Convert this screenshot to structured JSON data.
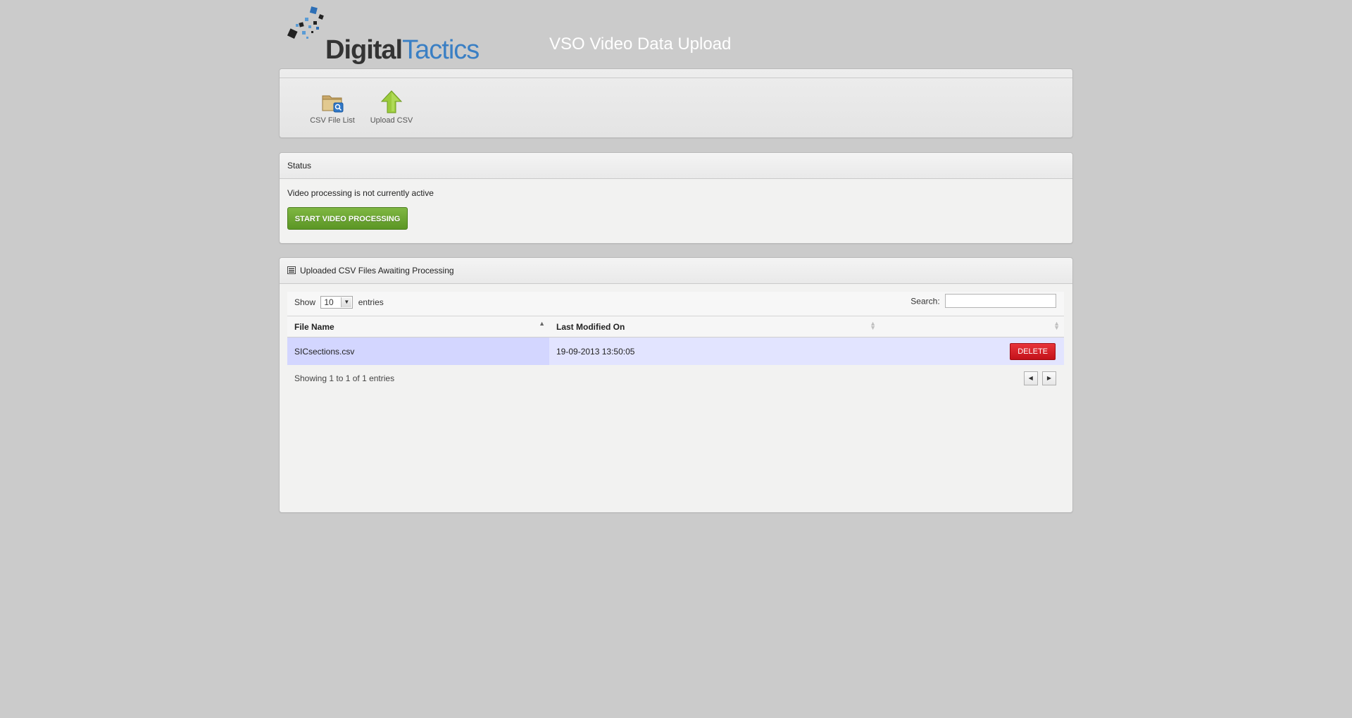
{
  "header": {
    "logo_part1": "Digital",
    "logo_part2": "Tactics",
    "title": "VSO Video Data Upload"
  },
  "toolbar": {
    "items": [
      {
        "label": "CSV File List",
        "icon": "folder-search-icon"
      },
      {
        "label": "Upload CSV",
        "icon": "upload-arrow-icon"
      }
    ]
  },
  "status": {
    "title": "Status",
    "message": "Video processing is not currently active",
    "button_label": "START VIDEO PROCESSING"
  },
  "files": {
    "title": "Uploaded CSV Files Awaiting Processing",
    "show_label": "Show",
    "entries_label": "entries",
    "length_value": "10",
    "search_label": "Search:",
    "search_value": "",
    "columns": [
      "File Name",
      "Last Modified On",
      ""
    ],
    "rows": [
      {
        "file_name": "SICsections.csv",
        "modified": "19-09-2013 13:50:05",
        "action": "DELETE"
      }
    ],
    "info": "Showing 1 to 1 of 1 entries"
  },
  "colors": {
    "page_bg": "#cbcbcb",
    "start_button": "#6aa533",
    "delete_button": "#d8212a",
    "row_highlight": "#e2e4ff",
    "brand_blue": "#3a7fc4"
  }
}
